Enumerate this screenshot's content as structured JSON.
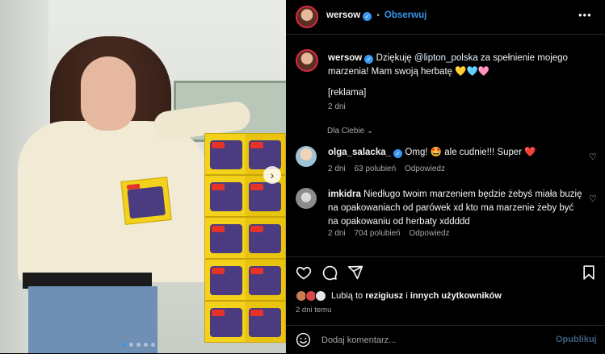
{
  "header": {
    "username": "wersow",
    "follow_label": "Obserwuj",
    "more_label": "•••"
  },
  "caption": {
    "username": "wersow",
    "text_before": "Dziękuję ",
    "mention": "@lipton_polska",
    "text_after": " za spełnienie mojego marzenia! Mam swoją herbatę 💛🩵🩷",
    "tag": "[reklama]",
    "time": "2 dni"
  },
  "sort_label": "Dla Ciebie",
  "comments": [
    {
      "username": "olga_salacka_",
      "text": " Omg! 🤩 ale cudnie!!! Super ❤️",
      "time": "2 dni",
      "likes": "63 polubień",
      "reply": "Odpowiedz"
    },
    {
      "username": "imkidra",
      "text": " Niedługo twoim marzeniem będzie żebyś miała buzię na opakowaniach od parówek xd kto ma marzenie żeby być na opakowaniu od herbaty xddddd",
      "time": "2 dni",
      "likes": "704 polubień",
      "reply": "Odpowiedz"
    }
  ],
  "liked_by": {
    "prefix": "Lubią to ",
    "user": "rezigiusz",
    "middle": " i ",
    "others": "innych użytkowników"
  },
  "post_time": "2 dni temu",
  "composer": {
    "placeholder": "Dodaj komentarz...",
    "publish": "Opublikuj"
  },
  "colors": {
    "accent": "#3897f0",
    "background": "#000000",
    "border": "#262626",
    "muted": "#a8a8a8"
  }
}
